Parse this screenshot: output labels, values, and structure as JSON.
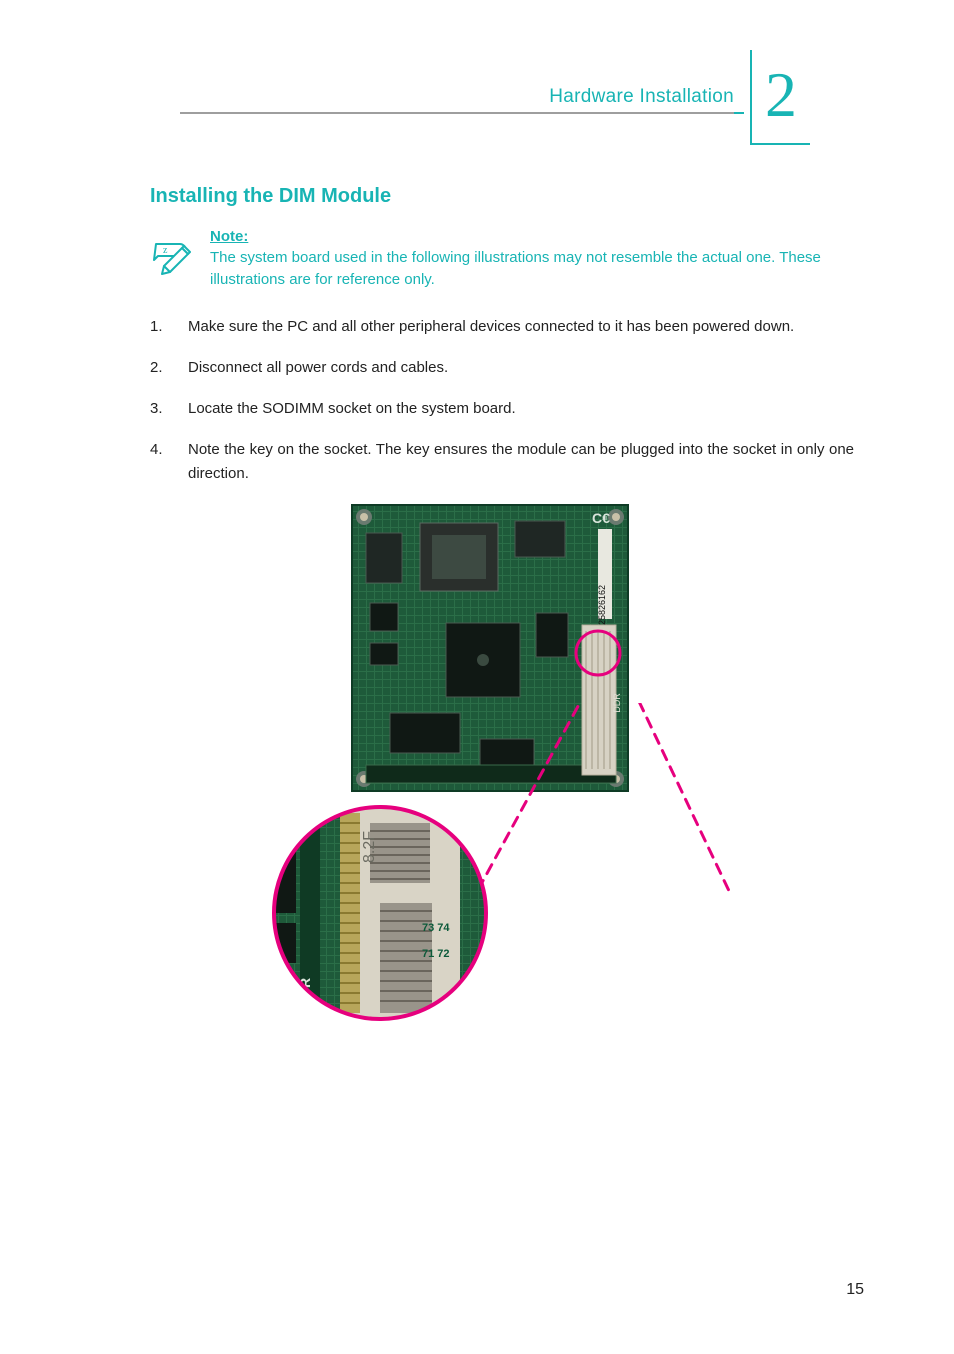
{
  "header": {
    "chapter_title": "Hardware Installation",
    "chapter_number": "2"
  },
  "section": {
    "title": "Installing the DIM Module"
  },
  "note": {
    "label": "Note:",
    "body": "The system board used in the following illustrations may not resemble the actual one. These illustrations are for reference only."
  },
  "steps": [
    "Make sure the PC and all other peripheral devices connected to it has been powered down.",
    "Disconnect all power cords and cables.",
    "Locate the SODIMM socket on the system board.",
    "Note the key on the socket. The key ensures the module can be plugged into the socket in only one direction."
  ],
  "figure": {
    "alt_main": "System board top view with SODIMM socket highlighted",
    "alt_zoom": "Close-up of SODIMM socket key",
    "board_sn": "000125826162",
    "socket_label": "DDR",
    "zoom_label": "8.2F"
  },
  "page_number": "15",
  "colors": {
    "accent": "#18b4b4",
    "callout": "#e6007e"
  }
}
